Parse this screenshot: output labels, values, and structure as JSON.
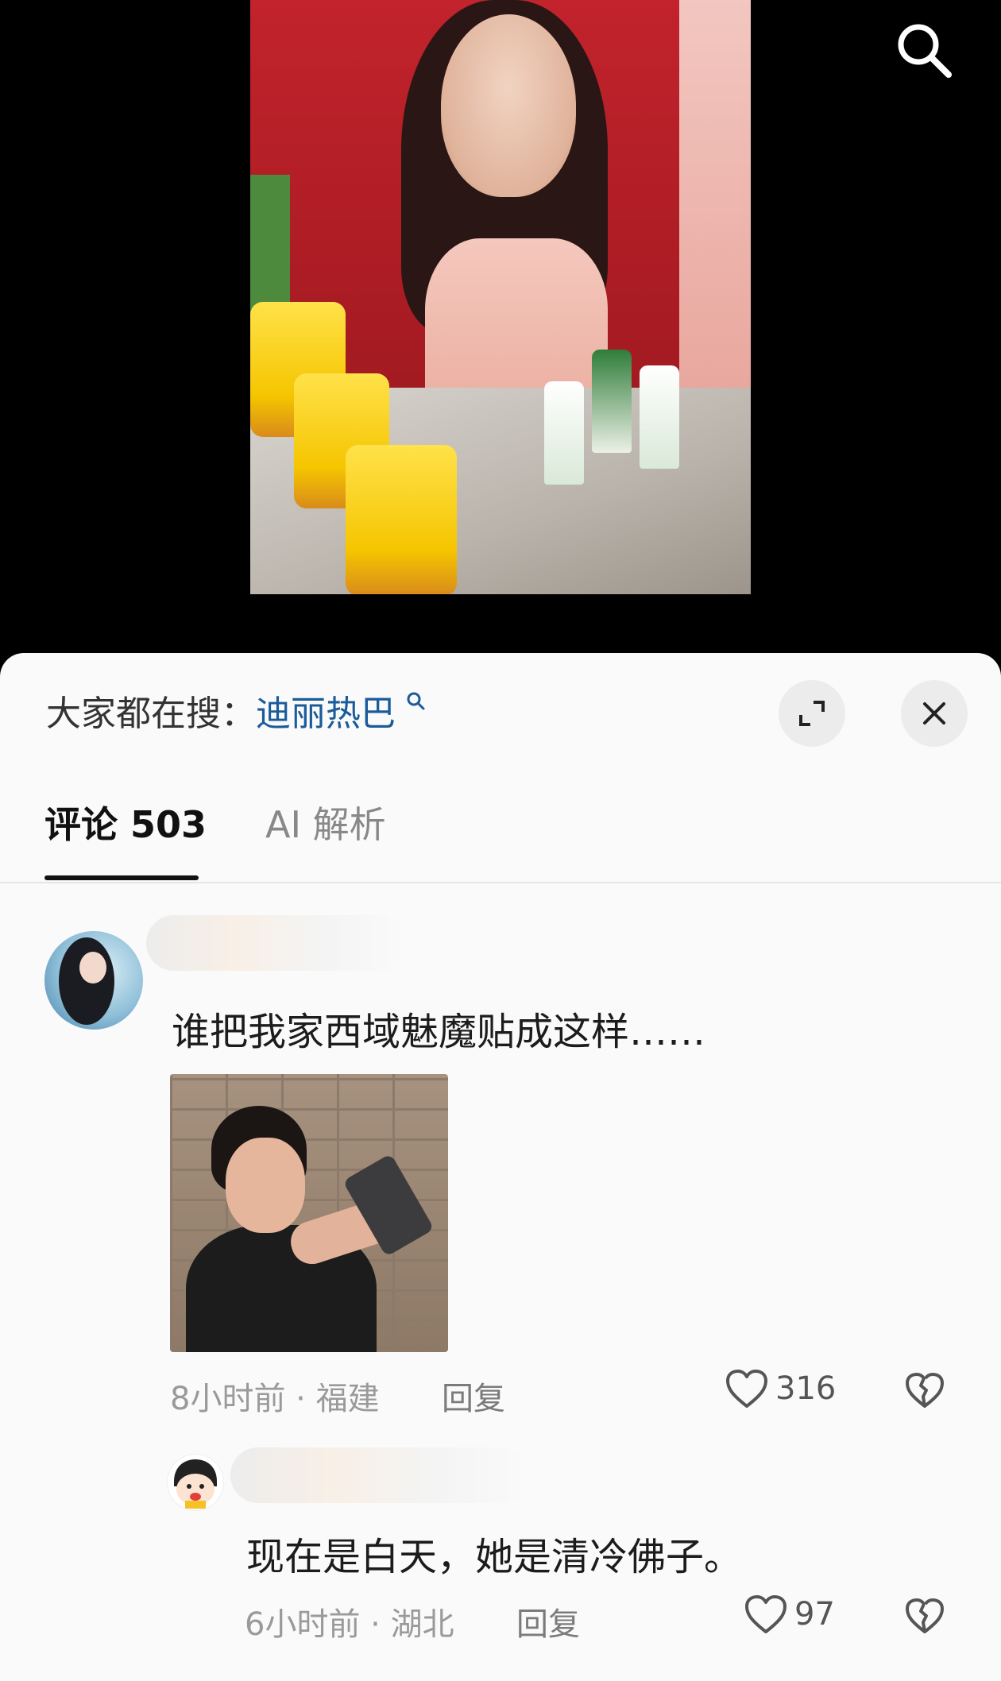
{
  "header": {
    "search_icon": "search-icon"
  },
  "media": {
    "description_icon": "ad-photo"
  },
  "sheet": {
    "hot_search_prefix": "大家都在搜：",
    "hot_search_keyword": "迪丽热巴",
    "expand_icon": "expand-icon",
    "close_icon": "close-icon"
  },
  "tabs": [
    {
      "label": "评论 503",
      "active": true
    },
    {
      "label": "AI 解析",
      "active": false
    }
  ],
  "comments": [
    {
      "text": "谁把我家西域魅魔贴成这样……",
      "time": "8小时前 · 福建",
      "reply_label": "回复",
      "likes": "316",
      "has_image": true
    }
  ],
  "replies": [
    {
      "text": "现在是白天，她是清冷佛子。",
      "time": "6小时前 · 湖北",
      "reply_label": "回复",
      "likes": "97"
    }
  ],
  "colors": {
    "keyword": "#1a5c9a",
    "sheet_bg": "#fafafa",
    "muted": "#9a9a9a"
  }
}
